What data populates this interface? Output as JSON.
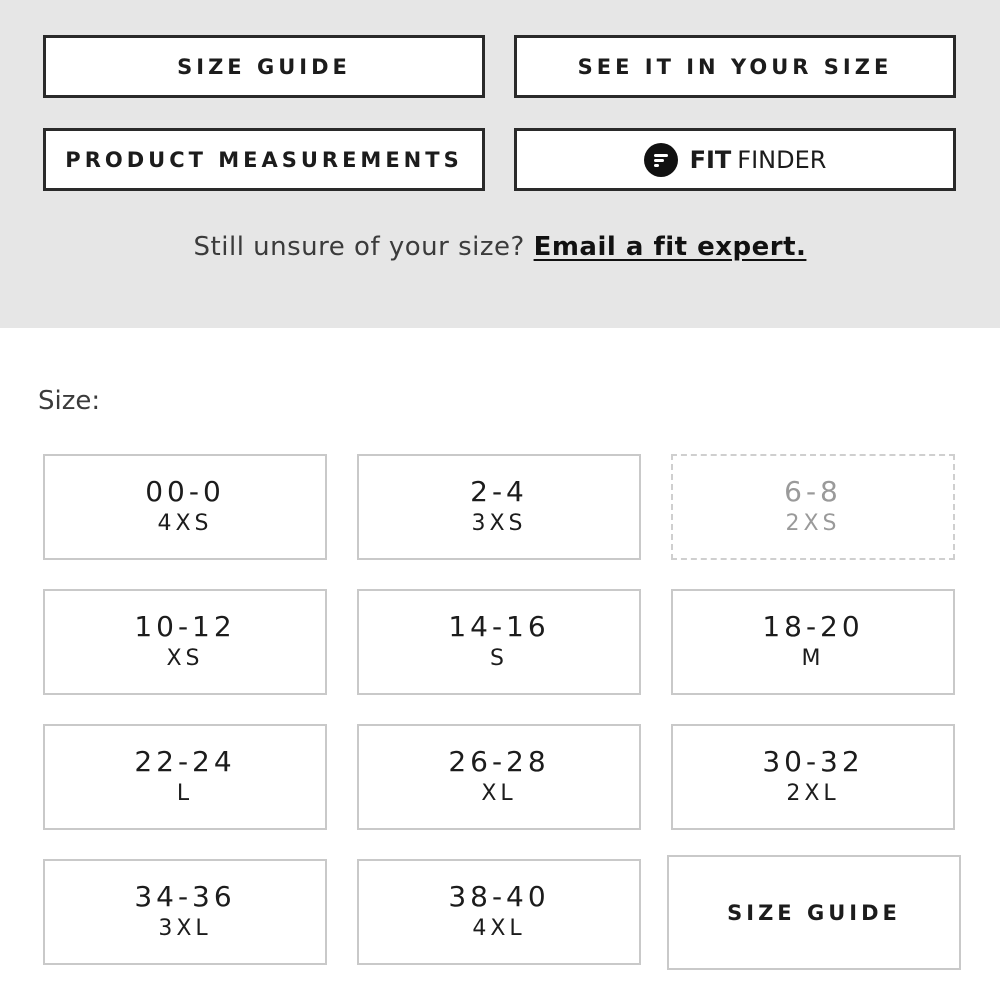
{
  "buttons": {
    "size_guide": "SIZE GUIDE",
    "see_in_size": "SEE IT IN YOUR SIZE",
    "product_measurements": "PRODUCT MEASUREMENTS",
    "fit_finder_bold": "FIT",
    "fit_finder_light": "FINDER"
  },
  "help": {
    "prompt": "Still unsure of your size?",
    "link": "Email a fit expert."
  },
  "size_section": {
    "label": "Size:",
    "options": [
      {
        "num": "00-0",
        "alpha": "4XS",
        "available": true
      },
      {
        "num": "2-4",
        "alpha": "3XS",
        "available": true
      },
      {
        "num": "6-8",
        "alpha": "2XS",
        "available": false
      },
      {
        "num": "10-12",
        "alpha": "XS",
        "available": true
      },
      {
        "num": "14-16",
        "alpha": "S",
        "available": true
      },
      {
        "num": "18-20",
        "alpha": "M",
        "available": true
      },
      {
        "num": "22-24",
        "alpha": "L",
        "available": true
      },
      {
        "num": "26-28",
        "alpha": "XL",
        "available": true
      },
      {
        "num": "30-32",
        "alpha": "2XL",
        "available": true
      },
      {
        "num": "34-36",
        "alpha": "3XL",
        "available": true
      },
      {
        "num": "38-40",
        "alpha": "4XL",
        "available": true
      }
    ],
    "guide_tile": "SIZE GUIDE"
  },
  "icons": {
    "fit_finder_logo": "fit-finder-logo-icon"
  },
  "colors": {
    "panel_bg": "#e6e6e6",
    "button_border": "#2a2a2a",
    "tile_border": "#c9c9c9",
    "unavailable_text": "#9a9a9a"
  }
}
